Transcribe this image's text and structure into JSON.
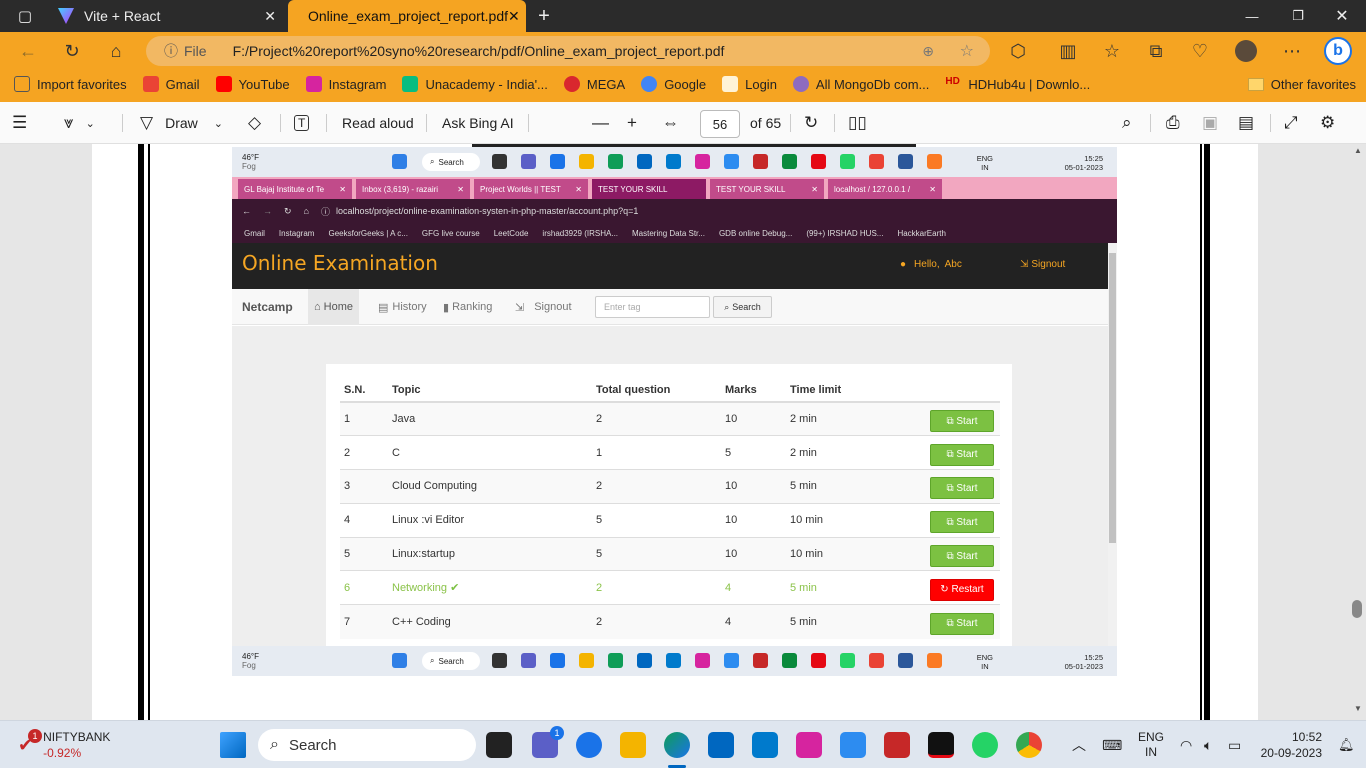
{
  "browser": {
    "tabs": [
      {
        "title": "Vite + React",
        "active": false
      },
      {
        "title": "Online_exam_project_report.pdf",
        "active": true
      }
    ],
    "new_tab_glyph": "+",
    "address": {
      "prefix": "File",
      "url": "F:/Project%20report%20syno%20research/pdf/Online_exam_project_report.pdf"
    },
    "favorites": [
      "Import favorites",
      "Gmail",
      "YouTube",
      "Instagram",
      "Unacademy - India'...",
      "MEGA",
      "Google",
      "Login",
      "All MongoDb com...",
      "HDHub4u | Downlo..."
    ],
    "other_favorites": "Other favorites",
    "colors": {
      "chrome": "#f5a422",
      "dark_tab": "#2b2b2b"
    }
  },
  "pdf_toolbar": {
    "draw": "Draw",
    "read_aloud": "Read aloud",
    "ask_bing": "Ask Bing AI",
    "page_current": "56",
    "page_total": "of 65"
  },
  "screenshot": {
    "taskbar": {
      "weather_temp": "46°F",
      "weather_desc": "Fog",
      "search": "Search",
      "lang1": "ENG",
      "lang2": "IN",
      "time": "15:25",
      "date": "05-01-2023"
    },
    "tabs": [
      "GL Bajaj Institute of Te",
      "Inbox (3,619) - razairi",
      "Project Worlds || TEST",
      "TEST YOUR SKILL",
      "TEST YOUR SKILL",
      "localhost / 127.0.0.1 /"
    ],
    "url": "localhost/project/online-examination-systen-in-php-master/account.php?q=1",
    "bookmarks": [
      "Gmail",
      "Instagram",
      "GeeksforGeeks | A c...",
      "GFG live course",
      "LeetCode",
      "irshad3929 (IRSHA...",
      "Mastering Data Str...",
      "GDB online Debug...",
      "(99+) IRSHAD HUS...",
      "HackkarEarth"
    ],
    "site": {
      "brand": "Online Examination",
      "hello": "Hello,",
      "user": "Abc",
      "signout_top": "Signout",
      "nav_brand": "Netcamp",
      "nav": {
        "home": "Home",
        "history": "History",
        "ranking": "Ranking",
        "signout": "Signout"
      },
      "tag_placeholder": "Enter tag",
      "search_btn": "Search",
      "table": {
        "headers": [
          "S.N.",
          "Topic",
          "Total question",
          "Marks",
          "Time limit"
        ],
        "rows": [
          {
            "sn": "1",
            "topic": "Java",
            "total": "2",
            "marks": "10",
            "time": "2 min",
            "action": "Start"
          },
          {
            "sn": "2",
            "topic": "C",
            "total": "1",
            "marks": "5",
            "time": "2 min",
            "action": "Start"
          },
          {
            "sn": "3",
            "topic": "Cloud Computing",
            "total": "2",
            "marks": "10",
            "time": "5 min",
            "action": "Start"
          },
          {
            "sn": "4",
            "topic": "Linux :vi Editor",
            "total": "5",
            "marks": "10",
            "time": "10 min",
            "action": "Start"
          },
          {
            "sn": "5",
            "topic": "Linux:startup",
            "total": "5",
            "marks": "10",
            "time": "10 min",
            "action": "Start"
          },
          {
            "sn": "6",
            "topic": "Networking",
            "total": "2",
            "marks": "4",
            "time": "5 min",
            "action": "Restart"
          },
          {
            "sn": "7",
            "topic": "C++ Coding",
            "total": "2",
            "marks": "4",
            "time": "5 min",
            "action": "Start"
          }
        ]
      },
      "colors": {
        "brand": "#f5a623",
        "start": "#7cc142",
        "restart": "#ff0000",
        "done_text": "#8bc34a"
      }
    }
  },
  "taskbar": {
    "stock_name": "NIFTYBANK",
    "stock_change": "-0.92%",
    "stock_badge": "1",
    "search": "Search",
    "chat_badge": "1",
    "lang1": "ENG",
    "lang2": "IN",
    "time": "10:52",
    "date": "20-09-2023"
  }
}
